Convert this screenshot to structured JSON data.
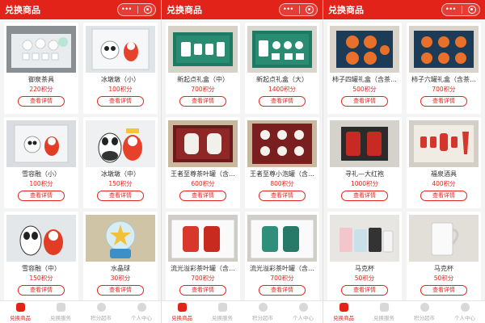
{
  "app": {
    "title": "兑换商品",
    "detail_label": "查看详情",
    "tabs": [
      "兑换商品",
      "兑换服务",
      "积分超市",
      "个人中心"
    ],
    "accent": "#e2231a"
  },
  "screens": [
    {
      "products": [
        {
          "name": "御泉茶具",
          "points": "220积分",
          "thumb": "teaset"
        },
        {
          "name": "冰墩墩（小）",
          "points": "100积分",
          "thumb": "panda-box"
        },
        {
          "name": "雪容融（小）",
          "points": "100积分",
          "thumb": "lantern-box"
        },
        {
          "name": "冰墩墩（中）",
          "points": "150积分",
          "thumb": "panda-fig"
        },
        {
          "name": "雪容融（中）",
          "points": "150积分",
          "thumb": "lantern-fig"
        },
        {
          "name": "水晶球",
          "points": "30积分",
          "thumb": "snowglobe"
        }
      ]
    },
    {
      "products": [
        {
          "name": "新起点礼盒（中）",
          "points": "700积分",
          "thumb": "giftbox-green"
        },
        {
          "name": "新起点礼盒（大）",
          "points": "1400积分",
          "thumb": "giftbox-green2"
        },
        {
          "name": "王者至尊茶叶罐（含…",
          "points": "600积分",
          "thumb": "tea-jars-red"
        },
        {
          "name": "王者至尊小泡罐（含…",
          "points": "800积分",
          "thumb": "tea-cups-red"
        },
        {
          "name": "流光溢彩茶叶罐（含…",
          "points": "700积分",
          "thumb": "jars-red-white"
        },
        {
          "name": "流光溢彩茶叶罐（含…",
          "points": "700积分",
          "thumb": "jars-green-white"
        }
      ]
    },
    {
      "products": [
        {
          "name": "柿子四罐礼盒（含茶…",
          "points": "500积分",
          "thumb": "persimmon4"
        },
        {
          "name": "柿子六罐礼盒（含茶…",
          "points": "700积分",
          "thumb": "persimmon6"
        },
        {
          "name": "寻礼—大红袍",
          "points": "1000积分",
          "thumb": "dahongpao"
        },
        {
          "name": "福泉酒具",
          "points": "400积分",
          "thumb": "wineset"
        },
        {
          "name": "马克杯",
          "points": "50积分",
          "thumb": "mugs"
        },
        {
          "name": "马克杯",
          "points": "50积分",
          "thumb": "mug-white"
        }
      ]
    }
  ]
}
